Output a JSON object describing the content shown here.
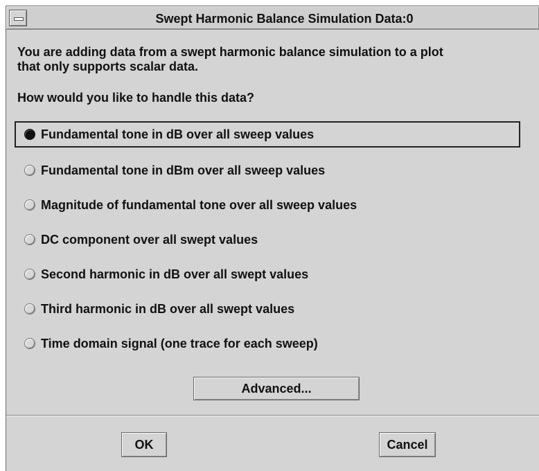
{
  "window": {
    "title": "Swept Harmonic Balance Simulation Data:0"
  },
  "message": {
    "line1": "You are adding data from a swept harmonic balance simulation to a plot",
    "line2": "that only supports scalar data."
  },
  "question": "How would you like to handle this data?",
  "options": [
    {
      "label": "Fundamental tone in dB over all sweep values",
      "selected": true
    },
    {
      "label": "Fundamental tone in dBm over all sweep values",
      "selected": false
    },
    {
      "label": "Magnitude of fundamental tone over all sweep values",
      "selected": false
    },
    {
      "label": "DC component over all swept values",
      "selected": false
    },
    {
      "label": "Second harmonic in dB over all swept values",
      "selected": false
    },
    {
      "label": "Third harmonic in dB over all swept values",
      "selected": false
    },
    {
      "label": "Time domain signal (one trace for each sweep)",
      "selected": false
    }
  ],
  "buttons": {
    "advanced": "Advanced...",
    "ok": "OK",
    "cancel": "Cancel"
  },
  "colors": {
    "dialog_background": "#d4d4d4",
    "text": "#111111",
    "selected_radio": "#111111"
  },
  "icons": {
    "window_menu": "window-menu-icon",
    "radio_selected": "radio-selected-icon",
    "radio_unselected": "radio-unselected-icon"
  }
}
